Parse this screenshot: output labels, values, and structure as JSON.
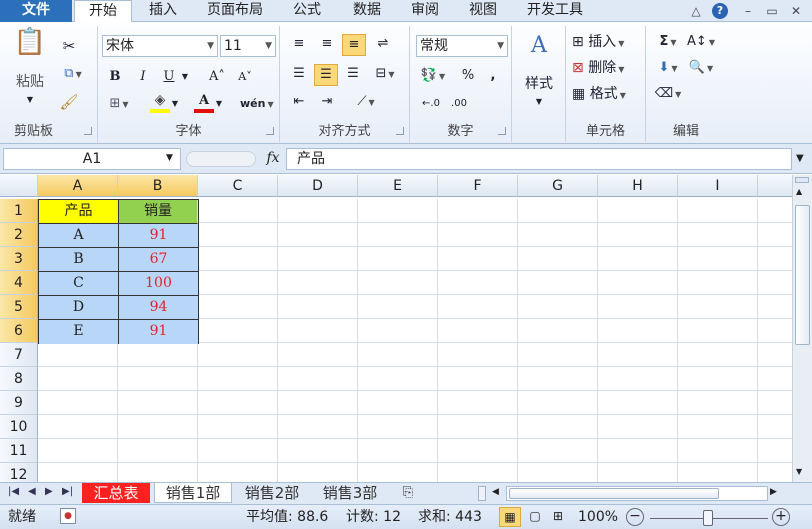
{
  "ribbon_tabs": [
    "文件",
    "开始",
    "插入",
    "页面布局",
    "公式",
    "数据",
    "审阅",
    "视图",
    "开发工具"
  ],
  "window_controls": {
    "minimize": "△",
    "help": "?",
    "restore": "▭",
    "close": "✕"
  },
  "clipboard": {
    "paste": "粘贴",
    "cut_icon": "✂",
    "group": "剪贴板"
  },
  "font": {
    "name": "宋体",
    "size": "11",
    "bold": "B",
    "italic": "I",
    "underline": "U",
    "grow": "A˄",
    "shrink": "A˅",
    "group": "字体",
    "phonetic": "wén"
  },
  "alignment": {
    "group": "对齐方式"
  },
  "number": {
    "format": "常规",
    "percent": "%",
    "comma": ",",
    "group": "数字"
  },
  "styles": {
    "label": "样式"
  },
  "cells": {
    "insert": "插入",
    "delete": "删除",
    "format": "格式",
    "group": "单元格"
  },
  "editing": {
    "sum": "Σ",
    "group": "编辑"
  },
  "formula_bar": {
    "name_box": "A1",
    "fx": "fx",
    "content": "产品"
  },
  "columns": [
    "A",
    "B",
    "C",
    "D",
    "E",
    "F",
    "G",
    "H",
    "I"
  ],
  "rows": [
    "1",
    "2",
    "3",
    "4",
    "5",
    "6",
    "7",
    "8",
    "9",
    "10",
    "11",
    "12"
  ],
  "table": {
    "headers": [
      "产品",
      "销量"
    ],
    "data": [
      [
        "A",
        "91"
      ],
      [
        "B",
        "67"
      ],
      [
        "C",
        "100"
      ],
      [
        "D",
        "94"
      ],
      [
        "E",
        "91"
      ]
    ]
  },
  "colors": {
    "header_a": "#ffff00",
    "header_b": "#92d050",
    "data_fill": "#b8d6f7",
    "value_text": "#e8202a",
    "sheet_active": "#ff2020"
  },
  "sheets": [
    "汇总表",
    "销售1部",
    "销售2部",
    "销售3部"
  ],
  "status": {
    "ready": "就绪",
    "average": "平均值: 88.6",
    "count": "计数: 12",
    "sum": "求和: 443",
    "zoom": "100%"
  }
}
